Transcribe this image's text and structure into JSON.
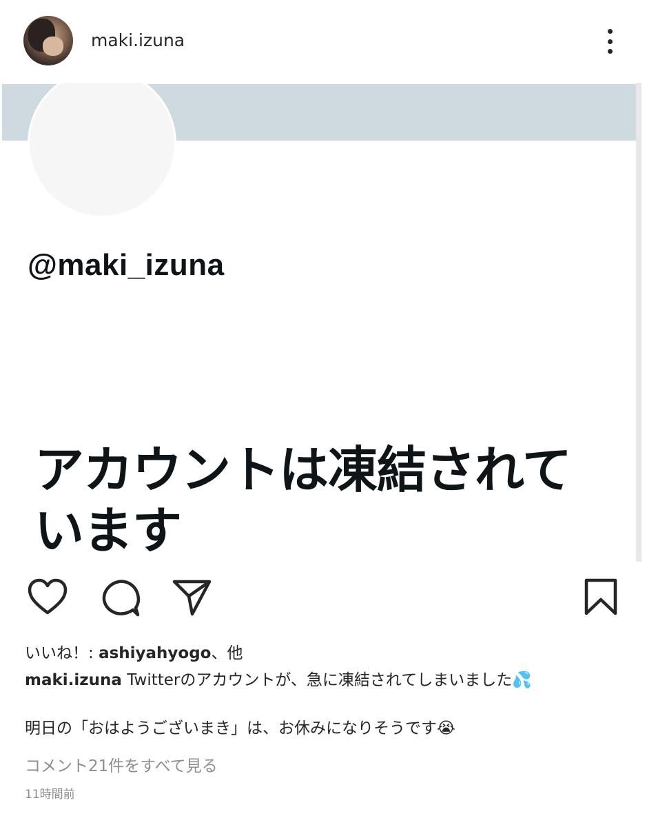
{
  "header": {
    "username": "maki.izuna"
  },
  "media": {
    "handle": "@maki_izuna",
    "suspended_message": "アカウントは凍結されています"
  },
  "actions": {
    "like_icon": "heart-icon",
    "comment_icon": "comment-icon",
    "share_icon": "share-icon",
    "save_icon": "bookmark-icon"
  },
  "post": {
    "likes_prefix": "いいね！: ",
    "likes_user": "ashiyahyogo",
    "likes_suffix": "、他",
    "caption_user": "maki.izuna",
    "caption_line1": " Twitterのアカウントが、急に凍結されてしまいました💦",
    "caption_line2": "明日の「おはようございまき」は、お休みになりそうです😭",
    "view_comments": "コメント21件をすべて見る",
    "timestamp": "11時間前"
  }
}
